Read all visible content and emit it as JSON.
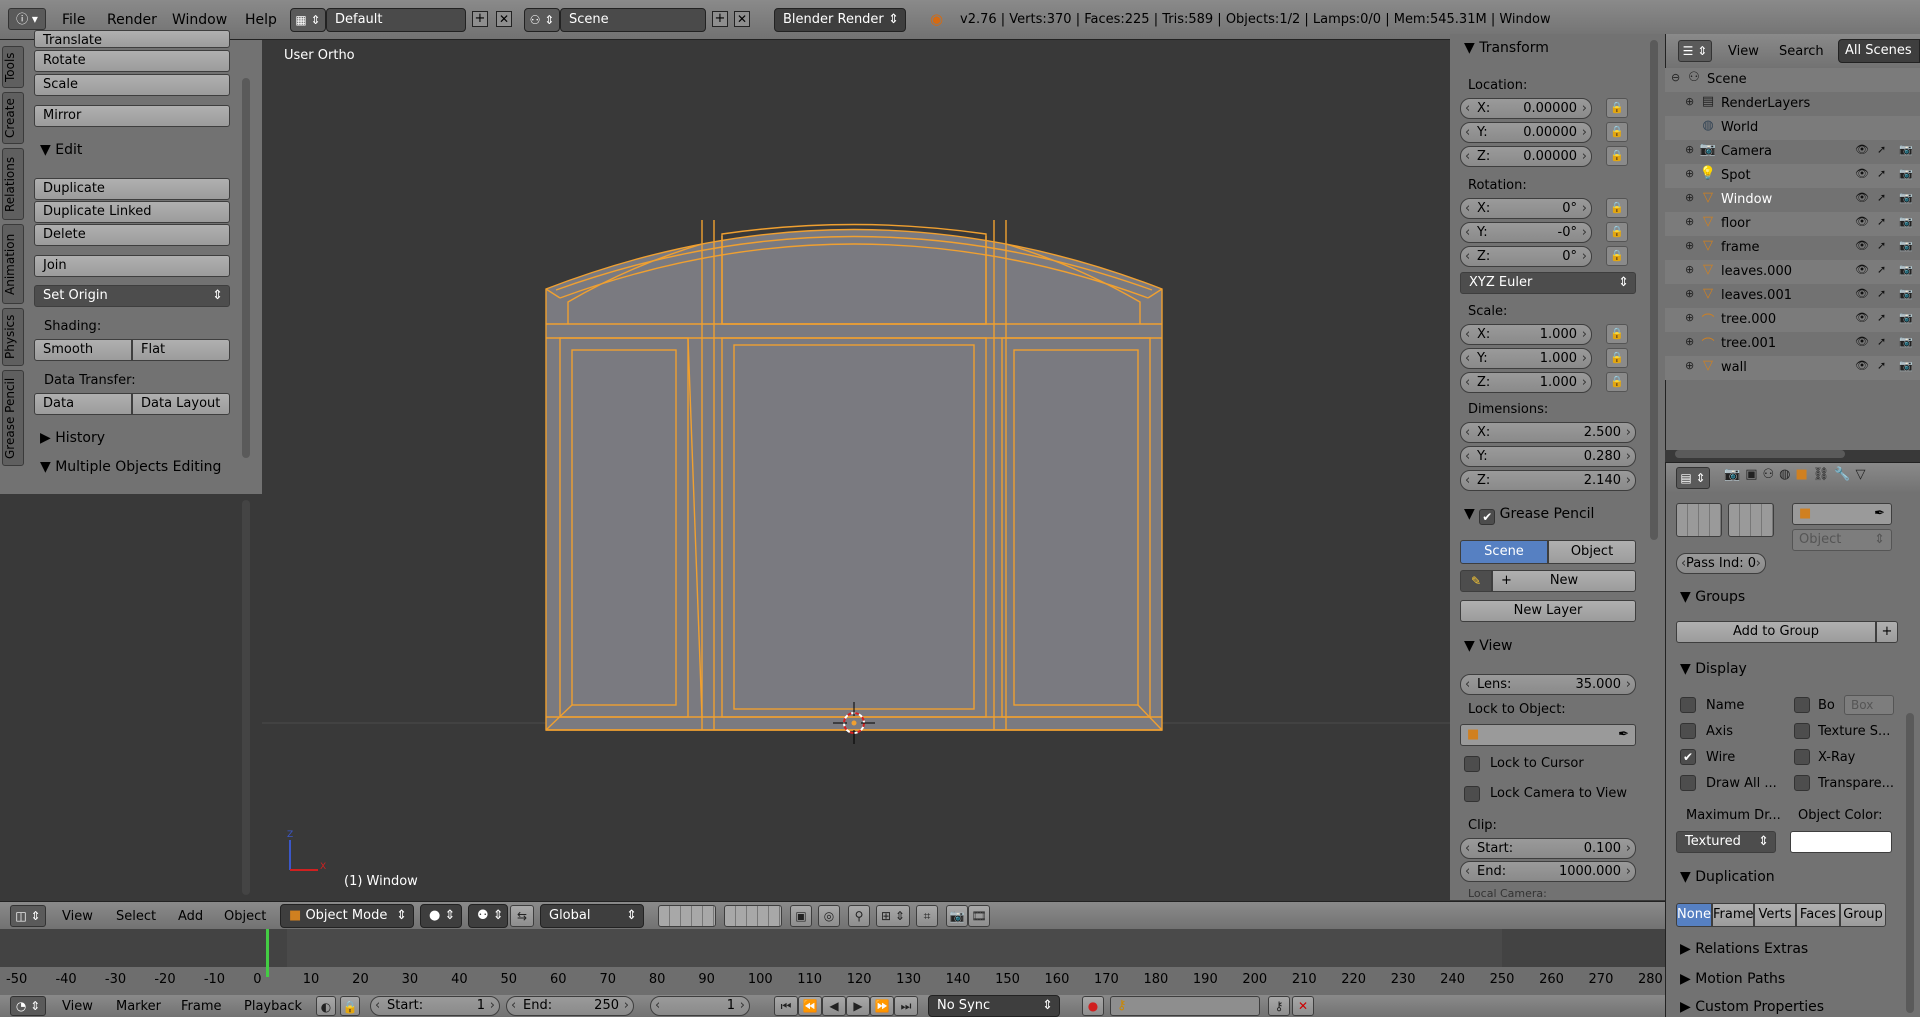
{
  "topbar": {
    "info_icon": "info-icon",
    "menus": [
      "File",
      "Render",
      "Window",
      "Help"
    ],
    "screen_layout": "Default",
    "scene": "Scene",
    "render_engine": "Blender Render",
    "stats": "v2.76 | Verts:370 | Faces:225 | Tris:589 | Objects:1/2 | Lamps:0/0 | Mem:545.31M | Window"
  },
  "tool_shelf": {
    "tabs": [
      "Tools",
      "Create",
      "Relations",
      "Animation",
      "Physics",
      "Grease Pencil"
    ],
    "cut_top": "Translate",
    "transform_buttons": [
      "Rotate",
      "Scale"
    ],
    "mirror": "Mirror",
    "edit_header": "Edit",
    "edit_buttons": [
      "Duplicate",
      "Duplicate Linked",
      "Delete"
    ],
    "join": "Join",
    "set_origin": "Set Origin",
    "shading_label": "Shading:",
    "smooth": "Smooth",
    "flat": "Flat",
    "data_transfer_label": "Data Transfer:",
    "data": "Data",
    "data_layout": "Data Layout",
    "history_header": "History",
    "multi_header": "Multiple Objects Editing"
  },
  "viewport": {
    "view_name": "User Ortho",
    "object_label": "(1) Window",
    "axis_z": "Z",
    "axis_x": "X"
  },
  "view3d_header": {
    "menus": [
      "View",
      "Select",
      "Add",
      "Object"
    ],
    "mode": "Object Mode",
    "orientation": "Global"
  },
  "n_panel": {
    "transform_header": "Transform",
    "location_label": "Location:",
    "location": [
      {
        "k": "X:",
        "v": "0.00000"
      },
      {
        "k": "Y:",
        "v": "0.00000"
      },
      {
        "k": "Z:",
        "v": "0.00000"
      }
    ],
    "rotation_label": "Rotation:",
    "rotation": [
      {
        "k": "X:",
        "v": "0°"
      },
      {
        "k": "Y:",
        "v": "-0°"
      },
      {
        "k": "Z:",
        "v": "0°"
      }
    ],
    "rotation_mode": "XYZ Euler",
    "scale_label": "Scale:",
    "scale": [
      {
        "k": "X:",
        "v": "1.000"
      },
      {
        "k": "Y:",
        "v": "1.000"
      },
      {
        "k": "Z:",
        "v": "1.000"
      }
    ],
    "dimensions_label": "Dimensions:",
    "dimensions": [
      {
        "k": "X:",
        "v": "2.500"
      },
      {
        "k": "Y:",
        "v": "0.280"
      },
      {
        "k": "Z:",
        "v": "2.140"
      }
    ],
    "grease_header": "Grease Pencil",
    "scene_btn": "Scene",
    "object_btn": "Object",
    "new_btn": "New",
    "new_layer_btn": "New Layer",
    "view_header": "View",
    "lens_label": "Lens:",
    "lens_value": "35.000",
    "lock_to_object": "Lock to Object:",
    "lock_cursor": "Lock to Cursor",
    "lock_camera": "Lock Camera to View",
    "clip_label": "Clip:",
    "clip_start_label": "Start:",
    "clip_start": "0.100",
    "clip_end_label": "End:",
    "clip_end": "1000.000",
    "local_camera": "Local Camera:"
  },
  "outliner": {
    "view": "View",
    "search": "Search",
    "all_scenes": "All Scenes",
    "items": [
      {
        "name": "Scene",
        "icon": "scene-icon",
        "level": 0
      },
      {
        "name": "RenderLayers",
        "icon": "renderlayers-icon",
        "level": 1
      },
      {
        "name": "World",
        "icon": "world-icon",
        "level": 1
      },
      {
        "name": "Camera",
        "icon": "camera-icon",
        "level": 1
      },
      {
        "name": "Spot",
        "icon": "lamp-icon",
        "level": 1
      },
      {
        "name": "Window",
        "icon": "mesh-icon",
        "level": 1
      },
      {
        "name": "floor",
        "icon": "mesh-icon",
        "level": 1
      },
      {
        "name": "frame",
        "icon": "mesh-icon",
        "level": 1
      },
      {
        "name": "leaves.000",
        "icon": "mesh-icon",
        "level": 1
      },
      {
        "name": "leaves.001",
        "icon": "mesh-icon",
        "level": 1
      },
      {
        "name": "tree.000",
        "icon": "curve-icon",
        "level": 1
      },
      {
        "name": "tree.001",
        "icon": "curve-icon",
        "level": 1
      },
      {
        "name": "wall",
        "icon": "mesh-icon",
        "level": 1
      }
    ]
  },
  "properties": {
    "object_dropdown": "Object",
    "pass_index": "Pass Ind: 0",
    "groups_header": "Groups",
    "add_to_group": "Add to Group",
    "display_header": "Display",
    "name": "Name",
    "bounds": "Bo",
    "box": "Box",
    "axis": "Axis",
    "texture_space": "Texture S...",
    "wire": "Wire",
    "xray": "X-Ray",
    "draw_all": "Draw All ...",
    "transparent": "Transpare...",
    "maximum_draw": "Maximum Dr...",
    "object_color": "Object Color:",
    "textured": "Textured",
    "duplication_header": "Duplication",
    "dup_options": [
      "None",
      "Frame",
      "Verts",
      "Faces",
      "Group"
    ],
    "relations_extras": "Relations Extras",
    "motion_paths": "Motion Paths",
    "custom_properties": "Custom Properties"
  },
  "timeline": {
    "ticks": [
      "-50",
      "-40",
      "-30",
      "-20",
      "-10",
      "0",
      "10",
      "20",
      "30",
      "40",
      "50",
      "60",
      "70",
      "80",
      "90",
      "100",
      "110",
      "120",
      "130",
      "140",
      "150",
      "160",
      "170",
      "180",
      "190",
      "200",
      "210",
      "220",
      "230",
      "240",
      "250",
      "260",
      "270",
      "280"
    ],
    "current_frame": 1,
    "menus": [
      "View",
      "Marker",
      "Frame",
      "Playback"
    ],
    "start_label": "Start:",
    "start": "1",
    "end_label": "End:",
    "end": "250",
    "frame": "1",
    "sync": "No Sync"
  },
  "colors": {
    "selection_orange": "#f0a030",
    "active_blue": "#5680c2",
    "viewport_bg": "#393939"
  }
}
